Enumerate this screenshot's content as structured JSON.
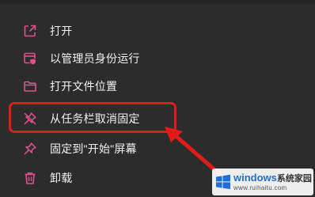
{
  "menu": {
    "items": [
      {
        "label": "打开",
        "icon": "open-external-icon"
      },
      {
        "label": "以管理员身份运行",
        "icon": "run-as-admin-shield-icon"
      },
      {
        "label": "打开文件位置",
        "icon": "folder-icon"
      },
      {
        "label": "从任务栏取消固定",
        "icon": "unpin-icon"
      },
      {
        "label": "固定到\"开始\"屏幕",
        "icon": "pin-icon"
      },
      {
        "label": "卸载",
        "icon": "trash-icon"
      }
    ]
  },
  "colors": {
    "background": "#2c2c2c",
    "icon_accent": "#e0518a",
    "text": "#f2f2f2",
    "highlight": "#e21a1a"
  },
  "watermark": {
    "brand": "windows",
    "brand_suffix": "系统家园",
    "url": "www.ruihaitu.com"
  }
}
